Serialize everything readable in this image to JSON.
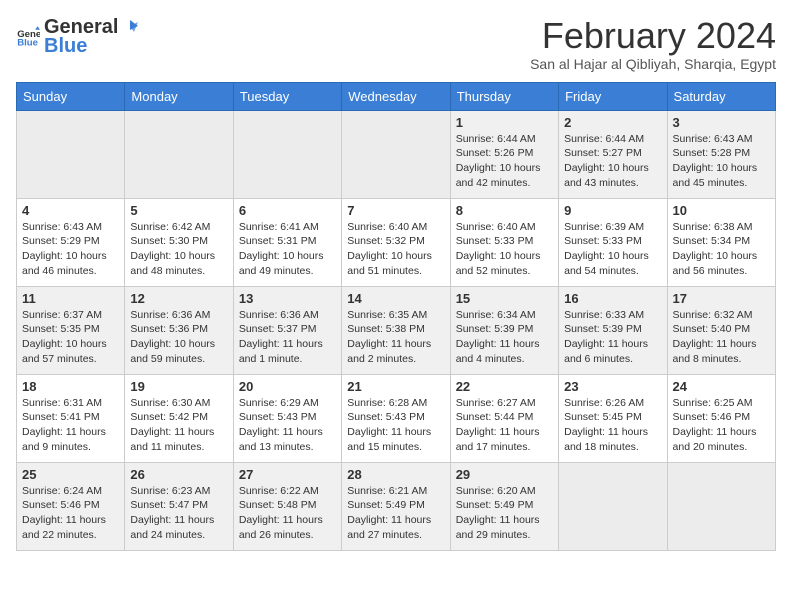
{
  "header": {
    "logo_general": "General",
    "logo_blue": "Blue",
    "month_title": "February 2024",
    "location": "San al Hajar al Qibliyah, Sharqia, Egypt"
  },
  "days_of_week": [
    "Sunday",
    "Monday",
    "Tuesday",
    "Wednesday",
    "Thursday",
    "Friday",
    "Saturday"
  ],
  "weeks": [
    [
      {
        "day": "",
        "info": ""
      },
      {
        "day": "",
        "info": ""
      },
      {
        "day": "",
        "info": ""
      },
      {
        "day": "",
        "info": ""
      },
      {
        "day": "1",
        "info": "Sunrise: 6:44 AM\nSunset: 5:26 PM\nDaylight: 10 hours\nand 42 minutes."
      },
      {
        "day": "2",
        "info": "Sunrise: 6:44 AM\nSunset: 5:27 PM\nDaylight: 10 hours\nand 43 minutes."
      },
      {
        "day": "3",
        "info": "Sunrise: 6:43 AM\nSunset: 5:28 PM\nDaylight: 10 hours\nand 45 minutes."
      }
    ],
    [
      {
        "day": "4",
        "info": "Sunrise: 6:43 AM\nSunset: 5:29 PM\nDaylight: 10 hours\nand 46 minutes."
      },
      {
        "day": "5",
        "info": "Sunrise: 6:42 AM\nSunset: 5:30 PM\nDaylight: 10 hours\nand 48 minutes."
      },
      {
        "day": "6",
        "info": "Sunrise: 6:41 AM\nSunset: 5:31 PM\nDaylight: 10 hours\nand 49 minutes."
      },
      {
        "day": "7",
        "info": "Sunrise: 6:40 AM\nSunset: 5:32 PM\nDaylight: 10 hours\nand 51 minutes."
      },
      {
        "day": "8",
        "info": "Sunrise: 6:40 AM\nSunset: 5:33 PM\nDaylight: 10 hours\nand 52 minutes."
      },
      {
        "day": "9",
        "info": "Sunrise: 6:39 AM\nSunset: 5:33 PM\nDaylight: 10 hours\nand 54 minutes."
      },
      {
        "day": "10",
        "info": "Sunrise: 6:38 AM\nSunset: 5:34 PM\nDaylight: 10 hours\nand 56 minutes."
      }
    ],
    [
      {
        "day": "11",
        "info": "Sunrise: 6:37 AM\nSunset: 5:35 PM\nDaylight: 10 hours\nand 57 minutes."
      },
      {
        "day": "12",
        "info": "Sunrise: 6:36 AM\nSunset: 5:36 PM\nDaylight: 10 hours\nand 59 minutes."
      },
      {
        "day": "13",
        "info": "Sunrise: 6:36 AM\nSunset: 5:37 PM\nDaylight: 11 hours\nand 1 minute."
      },
      {
        "day": "14",
        "info": "Sunrise: 6:35 AM\nSunset: 5:38 PM\nDaylight: 11 hours\nand 2 minutes."
      },
      {
        "day": "15",
        "info": "Sunrise: 6:34 AM\nSunset: 5:39 PM\nDaylight: 11 hours\nand 4 minutes."
      },
      {
        "day": "16",
        "info": "Sunrise: 6:33 AM\nSunset: 5:39 PM\nDaylight: 11 hours\nand 6 minutes."
      },
      {
        "day": "17",
        "info": "Sunrise: 6:32 AM\nSunset: 5:40 PM\nDaylight: 11 hours\nand 8 minutes."
      }
    ],
    [
      {
        "day": "18",
        "info": "Sunrise: 6:31 AM\nSunset: 5:41 PM\nDaylight: 11 hours\nand 9 minutes."
      },
      {
        "day": "19",
        "info": "Sunrise: 6:30 AM\nSunset: 5:42 PM\nDaylight: 11 hours\nand 11 minutes."
      },
      {
        "day": "20",
        "info": "Sunrise: 6:29 AM\nSunset: 5:43 PM\nDaylight: 11 hours\nand 13 minutes."
      },
      {
        "day": "21",
        "info": "Sunrise: 6:28 AM\nSunset: 5:43 PM\nDaylight: 11 hours\nand 15 minutes."
      },
      {
        "day": "22",
        "info": "Sunrise: 6:27 AM\nSunset: 5:44 PM\nDaylight: 11 hours\nand 17 minutes."
      },
      {
        "day": "23",
        "info": "Sunrise: 6:26 AM\nSunset: 5:45 PM\nDaylight: 11 hours\nand 18 minutes."
      },
      {
        "day": "24",
        "info": "Sunrise: 6:25 AM\nSunset: 5:46 PM\nDaylight: 11 hours\nand 20 minutes."
      }
    ],
    [
      {
        "day": "25",
        "info": "Sunrise: 6:24 AM\nSunset: 5:46 PM\nDaylight: 11 hours\nand 22 minutes."
      },
      {
        "day": "26",
        "info": "Sunrise: 6:23 AM\nSunset: 5:47 PM\nDaylight: 11 hours\nand 24 minutes."
      },
      {
        "day": "27",
        "info": "Sunrise: 6:22 AM\nSunset: 5:48 PM\nDaylight: 11 hours\nand 26 minutes."
      },
      {
        "day": "28",
        "info": "Sunrise: 6:21 AM\nSunset: 5:49 PM\nDaylight: 11 hours\nand 27 minutes."
      },
      {
        "day": "29",
        "info": "Sunrise: 6:20 AM\nSunset: 5:49 PM\nDaylight: 11 hours\nand 29 minutes."
      },
      {
        "day": "",
        "info": ""
      },
      {
        "day": "",
        "info": ""
      }
    ]
  ]
}
